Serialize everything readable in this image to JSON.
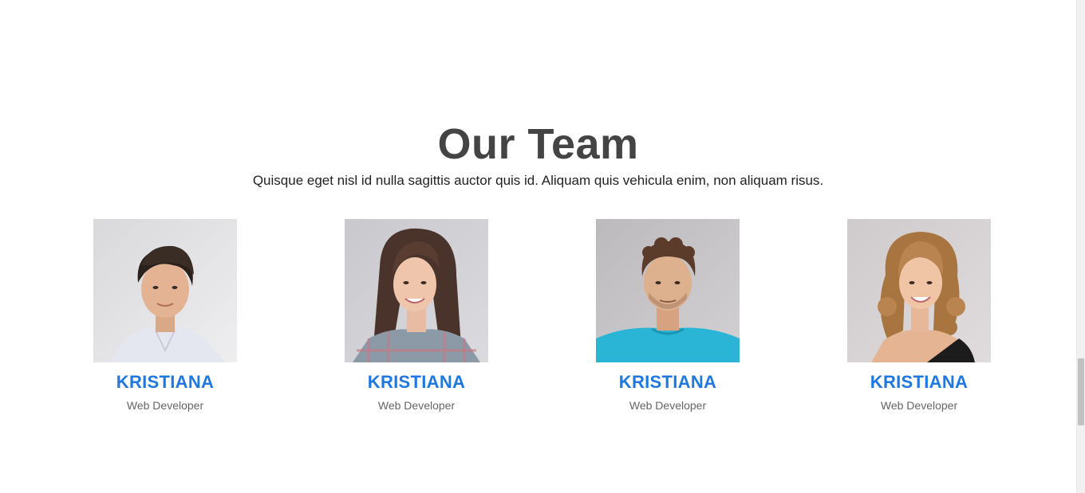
{
  "section": {
    "title": "Our Team",
    "subtitle": "Quisque eget nisl id nulla sagittis auctor quis id. Aliquam quis vehicula enim, non aliquam risus."
  },
  "team": [
    {
      "name": "KRISTIANA",
      "role": "Web Developer",
      "photo_icon": "man-portrait-icon"
    },
    {
      "name": "KRISTIANA",
      "role": "Web Developer",
      "photo_icon": "woman-portrait-icon"
    },
    {
      "name": "KRISTIANA",
      "role": "Web Developer",
      "photo_icon": "man-portrait-icon"
    },
    {
      "name": "KRISTIANA",
      "role": "Web Developer",
      "photo_icon": "woman-portrait-icon"
    }
  ],
  "colors": {
    "name_accent": "#1f78e0",
    "title": "#444444",
    "role": "#666666"
  }
}
